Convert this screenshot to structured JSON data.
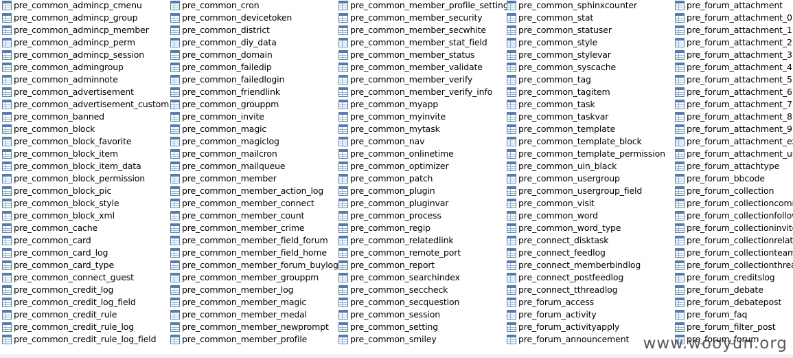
{
  "columns": [
    {
      "items": [
        "pre_common_admincp_cmenu",
        "pre_common_admincp_group",
        "pre_common_admincp_member",
        "pre_common_admincp_perm",
        "pre_common_admincp_session",
        "pre_common_admingroup",
        "pre_common_adminnote",
        "pre_common_advertisement",
        "pre_common_advertisement_custom",
        "pre_common_banned",
        "pre_common_block",
        "pre_common_block_favorite",
        "pre_common_block_item",
        "pre_common_block_item_data",
        "pre_common_block_permission",
        "pre_common_block_pic",
        "pre_common_block_style",
        "pre_common_block_xml",
        "pre_common_cache",
        "pre_common_card",
        "pre_common_card_log",
        "pre_common_card_type",
        "pre_common_connect_guest",
        "pre_common_credit_log",
        "pre_common_credit_log_field",
        "pre_common_credit_rule",
        "pre_common_credit_rule_log",
        "pre_common_credit_rule_log_field"
      ]
    },
    {
      "items": [
        "pre_common_cron",
        "pre_common_devicetoken",
        "pre_common_district",
        "pre_common_diy_data",
        "pre_common_domain",
        "pre_common_failedip",
        "pre_common_failedlogin",
        "pre_common_friendlink",
        "pre_common_grouppm",
        "pre_common_invite",
        "pre_common_magic",
        "pre_common_magiclog",
        "pre_common_mailcron",
        "pre_common_mailqueue",
        "pre_common_member",
        "pre_common_member_action_log",
        "pre_common_member_connect",
        "pre_common_member_count",
        "pre_common_member_crime",
        "pre_common_member_field_forum",
        "pre_common_member_field_home",
        "pre_common_member_forum_buylog",
        "pre_common_member_grouppm",
        "pre_common_member_log",
        "pre_common_member_magic",
        "pre_common_member_medal",
        "pre_common_member_newprompt",
        "pre_common_member_profile"
      ]
    },
    {
      "items": [
        "pre_common_member_profile_setting",
        "pre_common_member_security",
        "pre_common_member_secwhite",
        "pre_common_member_stat_field",
        "pre_common_member_status",
        "pre_common_member_validate",
        "pre_common_member_verify",
        "pre_common_member_verify_info",
        "pre_common_myapp",
        "pre_common_myinvite",
        "pre_common_mytask",
        "pre_common_nav",
        "pre_common_onlinetime",
        "pre_common_optimizer",
        "pre_common_patch",
        "pre_common_plugin",
        "pre_common_pluginvar",
        "pre_common_process",
        "pre_common_regip",
        "pre_common_relatedlink",
        "pre_common_remote_port",
        "pre_common_report",
        "pre_common_searchindex",
        "pre_common_seccheck",
        "pre_common_secquestion",
        "pre_common_session",
        "pre_common_setting",
        "pre_common_smiley"
      ]
    },
    {
      "items": [
        "pre_common_sphinxcounter",
        "pre_common_stat",
        "pre_common_statuser",
        "pre_common_style",
        "pre_common_stylevar",
        "pre_common_syscache",
        "pre_common_tag",
        "pre_common_tagitem",
        "pre_common_task",
        "pre_common_taskvar",
        "pre_common_template",
        "pre_common_template_block",
        "pre_common_template_permission",
        "pre_common_uin_black",
        "pre_common_usergroup",
        "pre_common_usergroup_field",
        "pre_common_visit",
        "pre_common_word",
        "pre_common_word_type",
        "pre_connect_disktask",
        "pre_connect_feedlog",
        "pre_connect_memberbindlog",
        "pre_connect_postfeedlog",
        "pre_connect_tthreadlog",
        "pre_forum_access",
        "pre_forum_activity",
        "pre_forum_activityapply",
        "pre_forum_announcement"
      ]
    },
    {
      "items": [
        "pre_forum_attachment",
        "pre_forum_attachment_0",
        "pre_forum_attachment_1",
        "pre_forum_attachment_2",
        "pre_forum_attachment_3",
        "pre_forum_attachment_4",
        "pre_forum_attachment_5",
        "pre_forum_attachment_6",
        "pre_forum_attachment_7",
        "pre_forum_attachment_8",
        "pre_forum_attachment_9",
        "pre_forum_attachment_exif",
        "pre_forum_attachment_unu",
        "pre_forum_attachtype",
        "pre_forum_bbcode",
        "pre_forum_collection",
        "pre_forum_collectioncomm",
        "pre_forum_collectionfollow",
        "pre_forum_collectioninvite",
        "pre_forum_collectionrelated",
        "pre_forum_collectionteamw",
        "pre_forum_collectionthread",
        "pre_forum_creditslog",
        "pre_forum_debate",
        "pre_forum_debatepost",
        "pre_forum_faq",
        "pre_forum_filter_post",
        "pre_forum_forum"
      ]
    }
  ],
  "icon": {
    "name": "table-icon",
    "border_color": "#5a7fb0",
    "header_color": "#4f7ab8",
    "grid_color": "#8fb0d8",
    "fill_color": "#ffffff"
  },
  "watermark": {
    "text": "www.wooyun.org"
  }
}
